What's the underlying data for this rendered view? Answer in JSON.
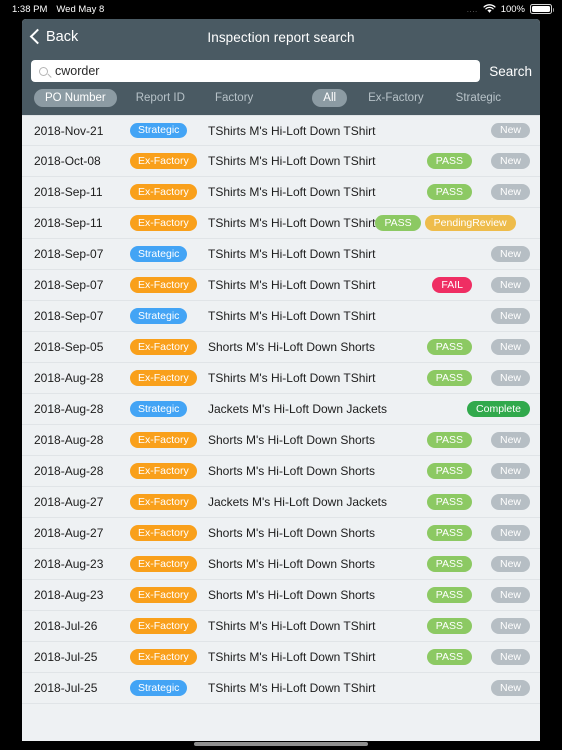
{
  "status_bar": {
    "time": "1:38 PM",
    "date": "Wed May 8",
    "signal_dots": "....",
    "wifi_icon": "wifi-icon",
    "battery_percent": "100%"
  },
  "nav": {
    "back_label": "Back",
    "back_icon": "chevron-left-icon",
    "title": "Inspection report search"
  },
  "search": {
    "icon": "search-icon",
    "value": "cworder",
    "placeholder": "",
    "button_label": "Search"
  },
  "filters": {
    "field_segments": [
      {
        "label": "PO Number",
        "active": true
      },
      {
        "label": "Report ID",
        "active": false
      },
      {
        "label": "Factory",
        "active": false
      }
    ],
    "type_segments": [
      {
        "label": "All",
        "active": true
      },
      {
        "label": "Ex-Factory",
        "active": false
      },
      {
        "label": "Strategic",
        "active": false
      }
    ]
  },
  "colors": {
    "nav_bg": "#4a5a63",
    "page_bg": "#eef1f3",
    "strategic": "#43a4f5",
    "ex_factory": "#f9a01b",
    "pass": "#8cc963",
    "fail": "#ef2e63",
    "pending_review": "#eebc4b",
    "new": "#b6bec4",
    "complete": "#31a94c"
  },
  "rows": [
    {
      "date": "2018-Nov-21",
      "type": "Strategic",
      "type_class": "pill-strategic",
      "desc": "TShirts M's Hi-Loft Down TShirt",
      "results": [],
      "status": "New",
      "status_class": "b-new"
    },
    {
      "date": "2018-Oct-08",
      "type": "Ex-Factory",
      "type_class": "pill-exfactory",
      "desc": "TShirts M's Hi-Loft Down TShirt",
      "results": [
        "PASS"
      ],
      "status": "New",
      "status_class": "b-new"
    },
    {
      "date": "2018-Sep-11",
      "type": "Ex-Factory",
      "type_class": "pill-exfactory",
      "desc": "TShirts M's Hi-Loft Down TShirt",
      "results": [
        "PASS"
      ],
      "status": "New",
      "status_class": "b-new"
    },
    {
      "date": "2018-Sep-11",
      "type": "Ex-Factory",
      "type_class": "pill-exfactory",
      "desc": "TShirts M's Hi-Loft Down TShirt",
      "results": [
        "PASS",
        "PendingReview"
      ],
      "status": "",
      "status_class": ""
    },
    {
      "date": "2018-Sep-07",
      "type": "Strategic",
      "type_class": "pill-strategic",
      "desc": "TShirts M's Hi-Loft Down TShirt",
      "results": [],
      "status": "New",
      "status_class": "b-new"
    },
    {
      "date": "2018-Sep-07",
      "type": "Ex-Factory",
      "type_class": "pill-exfactory",
      "desc": "TShirts M's Hi-Loft Down TShirt",
      "results": [
        "FAIL"
      ],
      "status": "New",
      "status_class": "b-new"
    },
    {
      "date": "2018-Sep-07",
      "type": "Strategic",
      "type_class": "pill-strategic",
      "desc": "TShirts M's Hi-Loft Down TShirt",
      "results": [],
      "status": "New",
      "status_class": "b-new"
    },
    {
      "date": "2018-Sep-05",
      "type": "Ex-Factory",
      "type_class": "pill-exfactory",
      "desc": "Shorts M's Hi-Loft Down Shorts",
      "results": [
        "PASS"
      ],
      "status": "New",
      "status_class": "b-new"
    },
    {
      "date": "2018-Aug-28",
      "type": "Ex-Factory",
      "type_class": "pill-exfactory",
      "desc": "TShirts M's Hi-Loft Down TShirt",
      "results": [
        "PASS"
      ],
      "status": "New",
      "status_class": "b-new"
    },
    {
      "date": "2018-Aug-28",
      "type": "Strategic",
      "type_class": "pill-strategic",
      "desc": "Jackets M's Hi-Loft Down Jackets",
      "results": [],
      "status": "Complete",
      "status_class": "b-complete"
    },
    {
      "date": "2018-Aug-28",
      "type": "Ex-Factory",
      "type_class": "pill-exfactory",
      "desc": "Shorts M's Hi-Loft Down Shorts",
      "results": [
        "PASS"
      ],
      "status": "New",
      "status_class": "b-new"
    },
    {
      "date": "2018-Aug-28",
      "type": "Ex-Factory",
      "type_class": "pill-exfactory",
      "desc": "Shorts M's Hi-Loft Down Shorts",
      "results": [
        "PASS"
      ],
      "status": "New",
      "status_class": "b-new"
    },
    {
      "date": "2018-Aug-27",
      "type": "Ex-Factory",
      "type_class": "pill-exfactory",
      "desc": "Jackets M's Hi-Loft Down Jackets",
      "results": [
        "PASS"
      ],
      "status": "New",
      "status_class": "b-new"
    },
    {
      "date": "2018-Aug-27",
      "type": "Ex-Factory",
      "type_class": "pill-exfactory",
      "desc": "Shorts M's Hi-Loft Down Shorts",
      "results": [
        "PASS"
      ],
      "status": "New",
      "status_class": "b-new"
    },
    {
      "date": "2018-Aug-23",
      "type": "Ex-Factory",
      "type_class": "pill-exfactory",
      "desc": "Shorts M's Hi-Loft Down Shorts",
      "results": [
        "PASS"
      ],
      "status": "New",
      "status_class": "b-new"
    },
    {
      "date": "2018-Aug-23",
      "type": "Ex-Factory",
      "type_class": "pill-exfactory",
      "desc": "Shorts M's Hi-Loft Down Shorts",
      "results": [
        "PASS"
      ],
      "status": "New",
      "status_class": "b-new"
    },
    {
      "date": "2018-Jul-26",
      "type": "Ex-Factory",
      "type_class": "pill-exfactory",
      "desc": "TShirts M's Hi-Loft Down TShirt",
      "results": [
        "PASS"
      ],
      "status": "New",
      "status_class": "b-new"
    },
    {
      "date": "2018-Jul-25",
      "type": "Ex-Factory",
      "type_class": "pill-exfactory",
      "desc": "TShirts M's Hi-Loft Down TShirt",
      "results": [
        "PASS"
      ],
      "status": "New",
      "status_class": "b-new"
    },
    {
      "date": "2018-Jul-25",
      "type": "Strategic",
      "type_class": "pill-strategic",
      "desc": "TShirts M's Hi-Loft Down TShirt",
      "results": [],
      "status": "New",
      "status_class": "b-new"
    }
  ]
}
